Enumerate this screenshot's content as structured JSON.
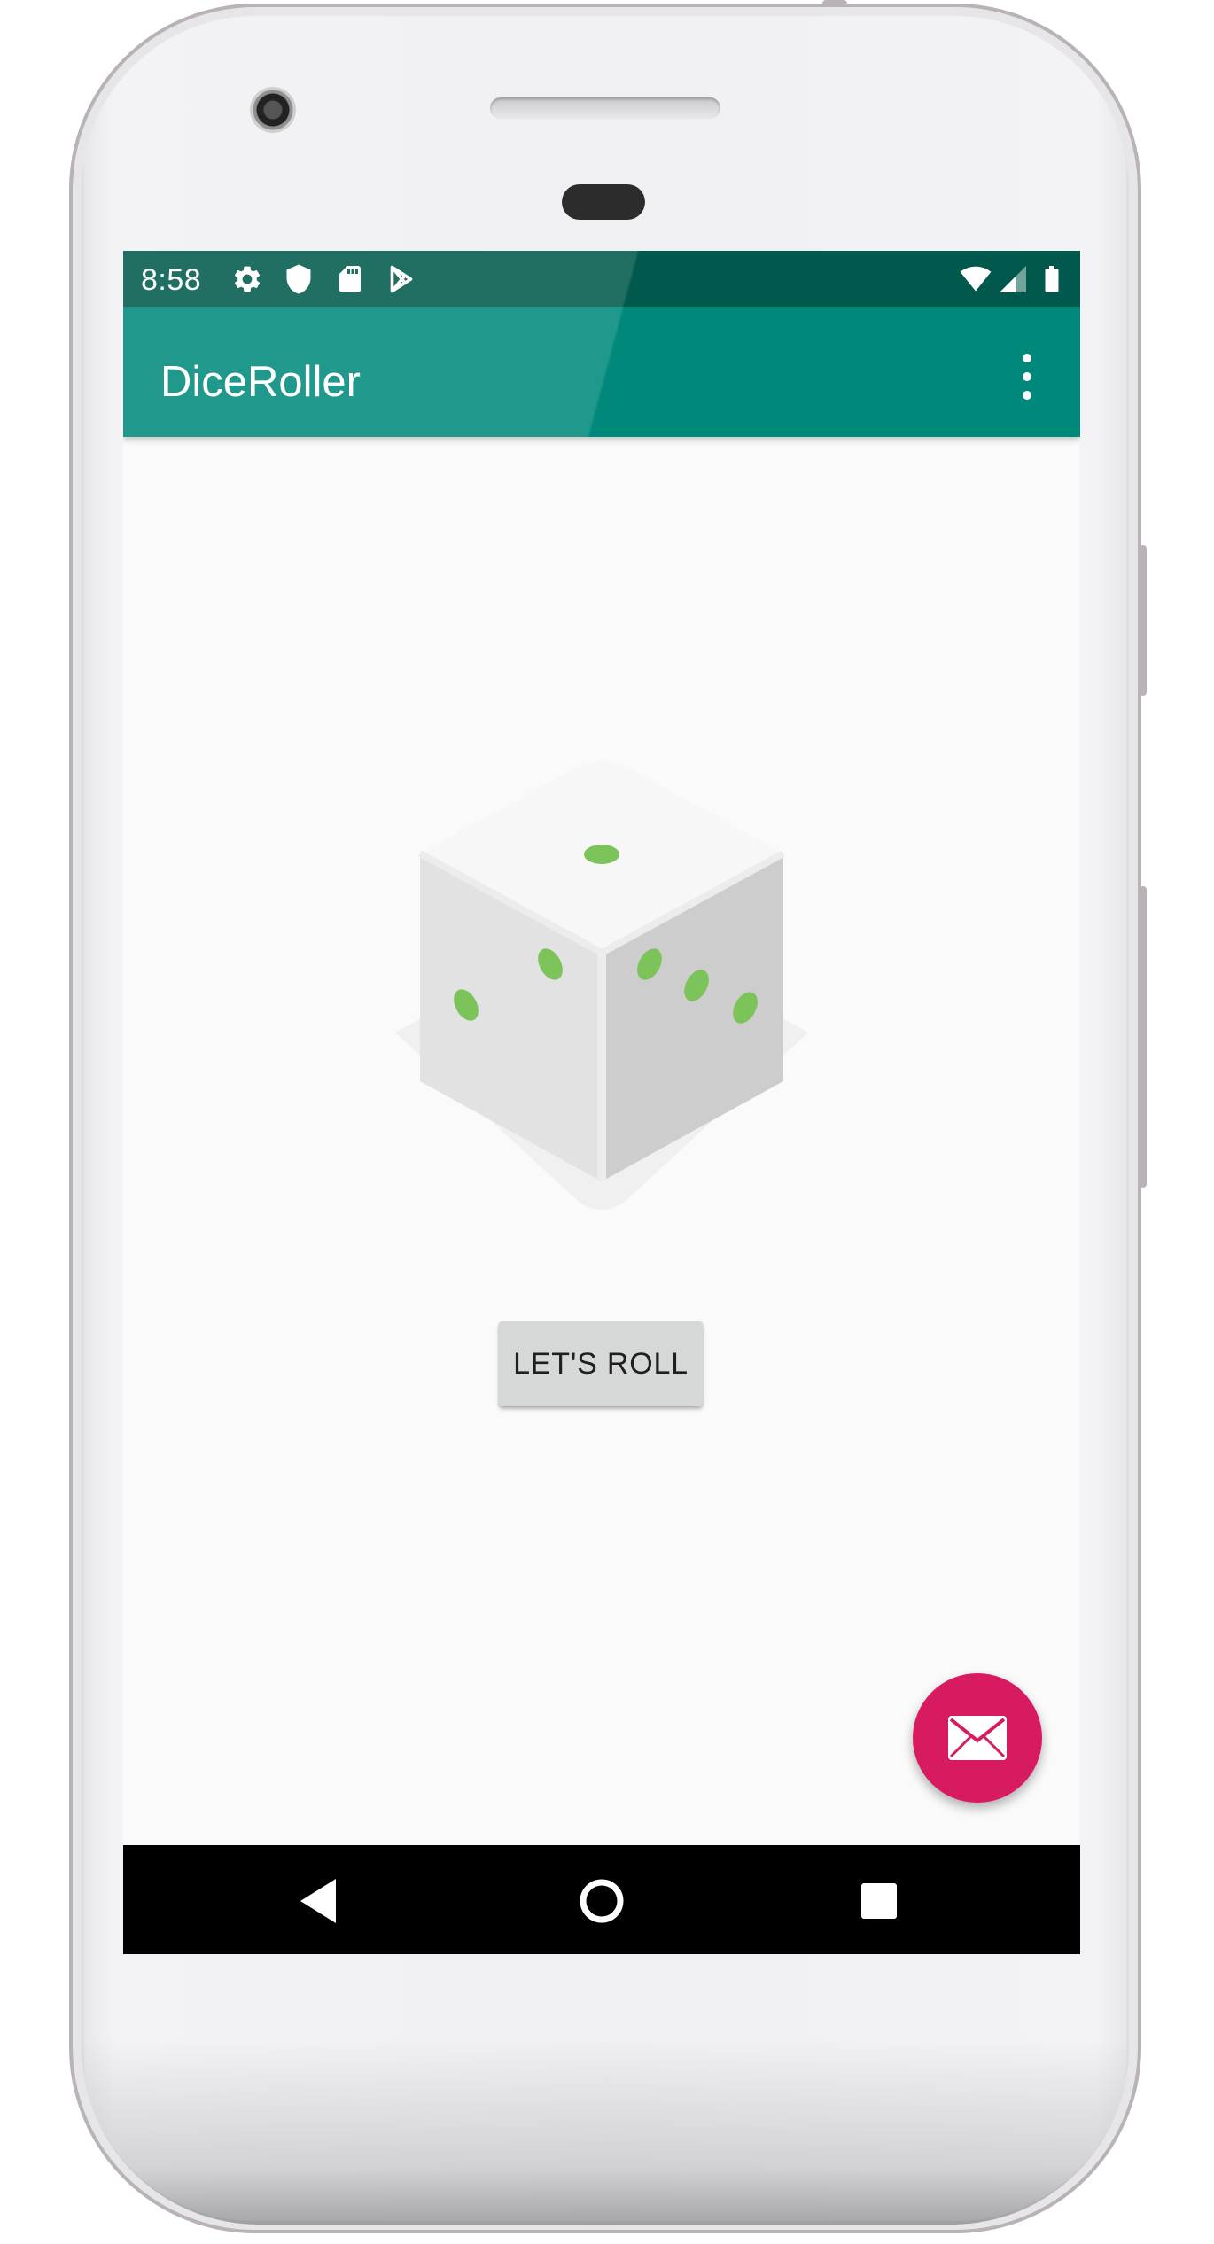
{
  "status_bar": {
    "time": "8:58",
    "left_icons": [
      "gear-icon",
      "shield-icon",
      "sd-card-icon",
      "play-store-icon"
    ],
    "right_icons": [
      "wifi-icon",
      "signal-icon",
      "battery-icon"
    ],
    "color": "#00594c"
  },
  "app_bar": {
    "title": "DiceRoller",
    "menu_icon": "more-vert-icon",
    "color": "#00897b"
  },
  "main": {
    "dice_image": "dice-icon",
    "roll_button_label": "LET'S ROLL"
  },
  "fab": {
    "icon": "mail-icon",
    "color": "#d81b60"
  },
  "nav_bar": {
    "buttons": [
      "back-icon",
      "home-icon",
      "recents-icon"
    ]
  }
}
